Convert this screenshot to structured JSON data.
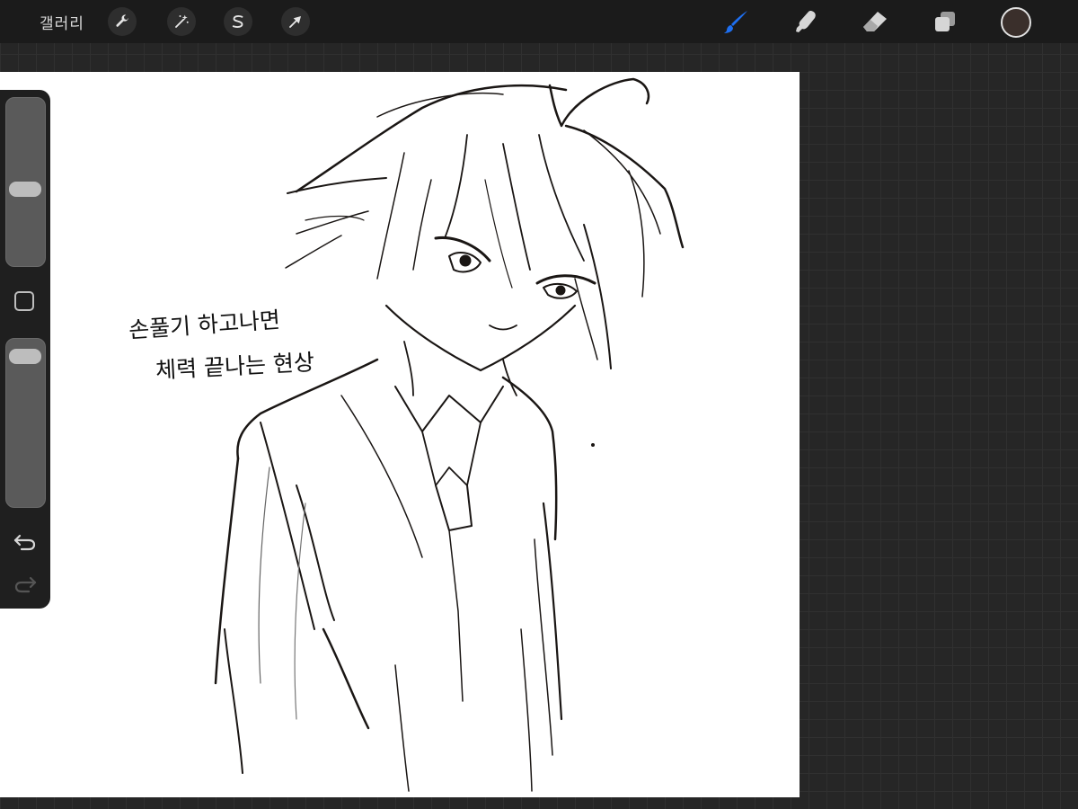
{
  "app": {
    "gallery_label": "갤러리",
    "current_color": "#3a2f2b",
    "accent_color": "#1e6ff0"
  },
  "toolbar": {
    "left_tools": [
      {
        "name": "actions",
        "icon": "wrench-icon"
      },
      {
        "name": "adjustments",
        "icon": "magic-wand-icon"
      },
      {
        "name": "selection",
        "icon": "selection-s-icon"
      },
      {
        "name": "transform",
        "icon": "arrow-cursor-icon"
      }
    ],
    "right_tools": [
      {
        "name": "brush",
        "icon": "brush-icon",
        "active": true
      },
      {
        "name": "smudge",
        "icon": "smudge-finger-icon"
      },
      {
        "name": "eraser",
        "icon": "eraser-icon"
      },
      {
        "name": "layers",
        "icon": "layers-icon"
      }
    ]
  },
  "sidebar": {
    "brush_size_level": 0.55,
    "opacity_level": 0.05,
    "undo_icon": "undo-arrow-icon",
    "redo_icon": "redo-arrow-icon",
    "modify_icon": "square-modify-icon"
  },
  "canvas": {
    "handwriting_line1": "손풀기 하고나면",
    "handwriting_line2": "체력 끝나는 현상"
  }
}
